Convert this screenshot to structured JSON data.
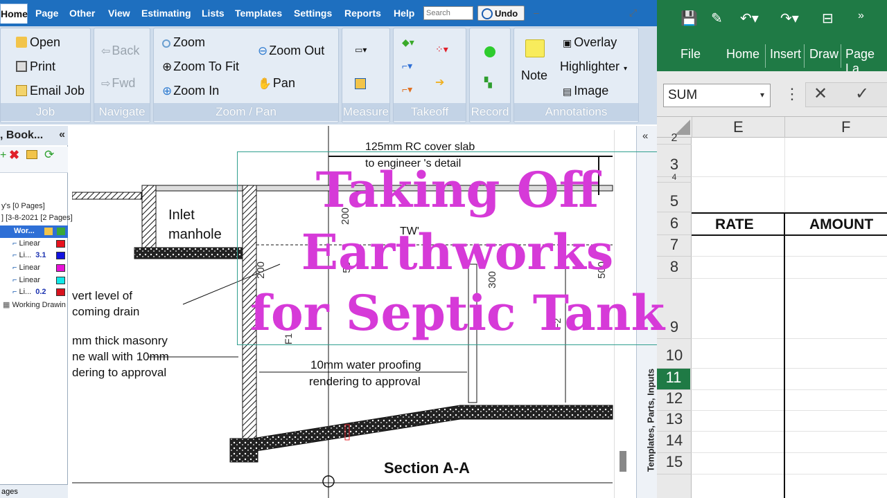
{
  "menubar": {
    "items": [
      "Home",
      "Page",
      "Other",
      "View",
      "Estimating",
      "Lists",
      "Templates",
      "Settings",
      "Reports",
      "Help"
    ],
    "search_placeholder": "Search",
    "undo_label": "Undo"
  },
  "ribbon": {
    "job": {
      "label": "Job",
      "open": "Open",
      "print": "Print",
      "email": "Email Job"
    },
    "navigate": {
      "label": "Navigate",
      "back": "Back",
      "fwd": "Fwd"
    },
    "zoom": {
      "label": "Zoom / Pan",
      "zoom": "Zoom",
      "zoom_fit": "Zoom To Fit",
      "zoom_in": "Zoom In",
      "zoom_out": "Zoom Out",
      "pan": "Pan"
    },
    "measure": {
      "label": "Measure"
    },
    "takeoff": {
      "label": "Takeoff"
    },
    "record": {
      "label": "Record"
    },
    "annotations": {
      "label": "Annotations",
      "note": "Note",
      "overlay": "Overlay",
      "highlighter": "Highlighter",
      "image": "Image"
    }
  },
  "left_panel": {
    "header": ", Book...",
    "rows": [
      {
        "text": "y's [0 Pages]"
      },
      {
        "text": "] [3-8-2021  [2 Pages]"
      },
      {
        "text": "Wor..."
      },
      {
        "text": "Linear",
        "value": ""
      },
      {
        "text": "Li...",
        "value": "3.1"
      },
      {
        "text": "Linear",
        "value": ""
      },
      {
        "text": "Linear",
        "value": ""
      },
      {
        "text": "Li...",
        "value": "0.2"
      },
      {
        "text": "Working Drawin"
      }
    ],
    "swatch_colors": [
      "#e8121e",
      "#1212e0",
      "#e812d8",
      "#12e8e8",
      "#d8121e"
    ],
    "footer": "ages"
  },
  "drawing": {
    "cover_slab": "125mm RC cover slab",
    "cover_slab_2": "to engineer 's detail",
    "inlet": "Inlet",
    "manhole": "manhole",
    "tw": "TW'",
    "invert_1": "vert level of",
    "invert_2": "coming drain",
    "masonry_1": "mm thick masonry",
    "masonry_2": "ne wall with  10mm",
    "masonry_3": "dering to approval",
    "waterproof_1": "10mm water proofing",
    "waterproof_2": "rendering to approval",
    "dim_200a": "200",
    "dim_200b": "200",
    "dim_50": "50",
    "dim_300": "300",
    "dim_500": "500",
    "f1": "F1",
    "f2": "F2",
    "section": "Section A-A"
  },
  "right_dock": {
    "label": "Templates, Parts, Inputs"
  },
  "overlay_title": {
    "line1": "Taking Off",
    "line2": "Earthworks",
    "line3": "for Septic Tank"
  },
  "excel": {
    "tabs": [
      "File",
      "Home",
      "Insert",
      "Draw",
      "Page La"
    ],
    "namebox": "SUM",
    "columns": [
      "E",
      "F"
    ],
    "rows": [
      "2",
      "3",
      "4",
      "5",
      "6",
      "7",
      "8",
      "9",
      "10",
      "11",
      "12",
      "13",
      "14",
      "15"
    ],
    "active_row": "11",
    "header_rate": "RATE",
    "header_amount": "AMOUNT"
  },
  "colors": {
    "menubar": "#1e6fbf",
    "excel_green": "#1f7a45",
    "title_magenta": "#d63ad8"
  }
}
